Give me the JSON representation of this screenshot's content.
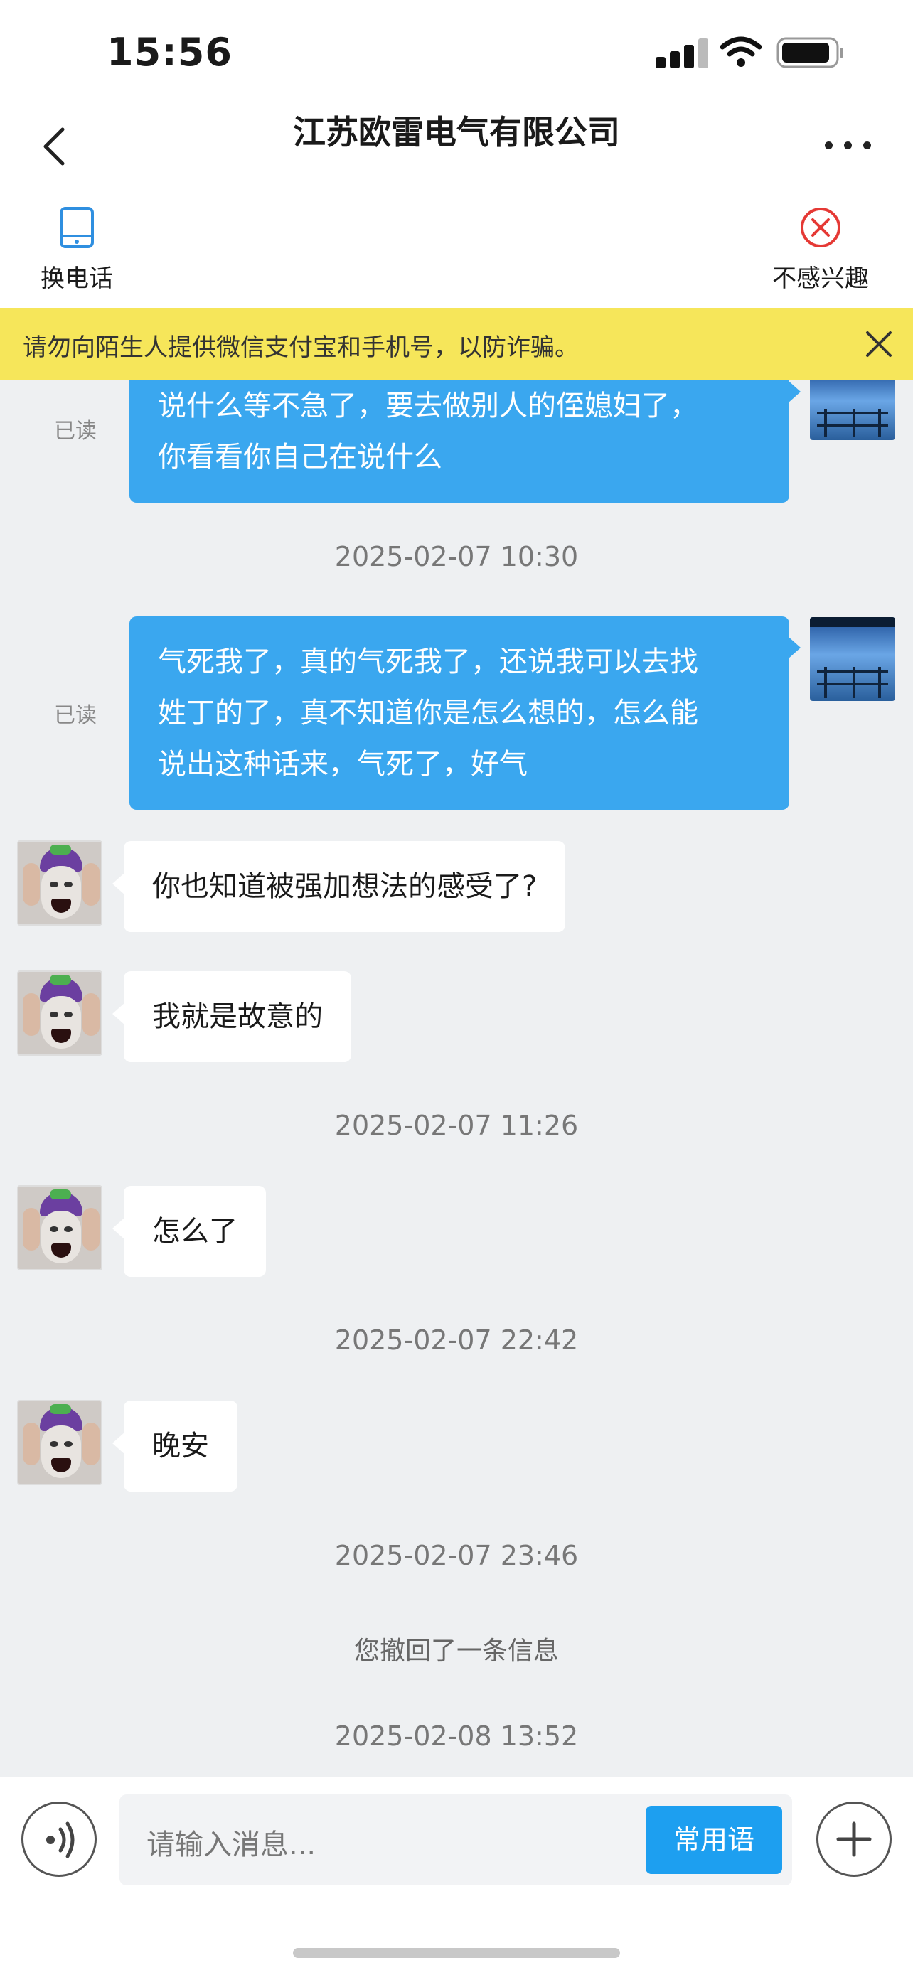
{
  "status_bar": {
    "time": "15:56"
  },
  "header": {
    "title": "江苏欧雷电气有限公司"
  },
  "actions": {
    "change_phone": "换电话",
    "not_interested": "不感兴趣"
  },
  "notice": {
    "text": "请勿向陌生人提供微信支付宝和手机号，以防诈骗。"
  },
  "messages": [
    {
      "type": "sent",
      "text": "说什么等不急了，要去做别人的侄媳妇了，你看看你自己在说什么",
      "lines": [
        "说什么等不急了，要去做别人的侄媳妇了，",
        "你看看你自己在说什么"
      ],
      "status": "已读"
    },
    {
      "type": "timestamp",
      "text": "2025-02-07 10:30"
    },
    {
      "type": "sent",
      "text": "气死我了，真的气死我了，还说我可以去找姓丁的了，真不知道你是怎么想的，怎么能说出这种话来，气死了，好气",
      "lines": [
        "气死我了，真的气死我了，还说我可以去找",
        "姓丁的了，真不知道你是怎么想的，怎么能",
        "说出这种话来，气死了，好气"
      ],
      "status": "已读"
    },
    {
      "type": "received",
      "text": "你也知道被强加想法的感受了?"
    },
    {
      "type": "received",
      "text": "我就是故意的"
    },
    {
      "type": "timestamp",
      "text": "2025-02-07 11:26"
    },
    {
      "type": "received",
      "text": "怎么了"
    },
    {
      "type": "timestamp",
      "text": "2025-02-07 22:42"
    },
    {
      "type": "received",
      "text": "晚安"
    },
    {
      "type": "timestamp",
      "text": "2025-02-07 23:46"
    },
    {
      "type": "system",
      "text": "您撤回了一条信息"
    },
    {
      "type": "timestamp",
      "text": "2025-02-08 13:52"
    }
  ],
  "input_bar": {
    "placeholder": "请输入消息...",
    "phrases_label": "常用语"
  },
  "colors": {
    "accent": "#1d9ff0",
    "sent_bubble": "#3aa7ef",
    "notice_bg": "#f6e65a",
    "danger": "#e53935"
  },
  "icons": [
    "back-icon",
    "more-icon",
    "phone-icon",
    "not-interested-icon",
    "close-icon",
    "voice-icon",
    "plus-icon"
  ]
}
